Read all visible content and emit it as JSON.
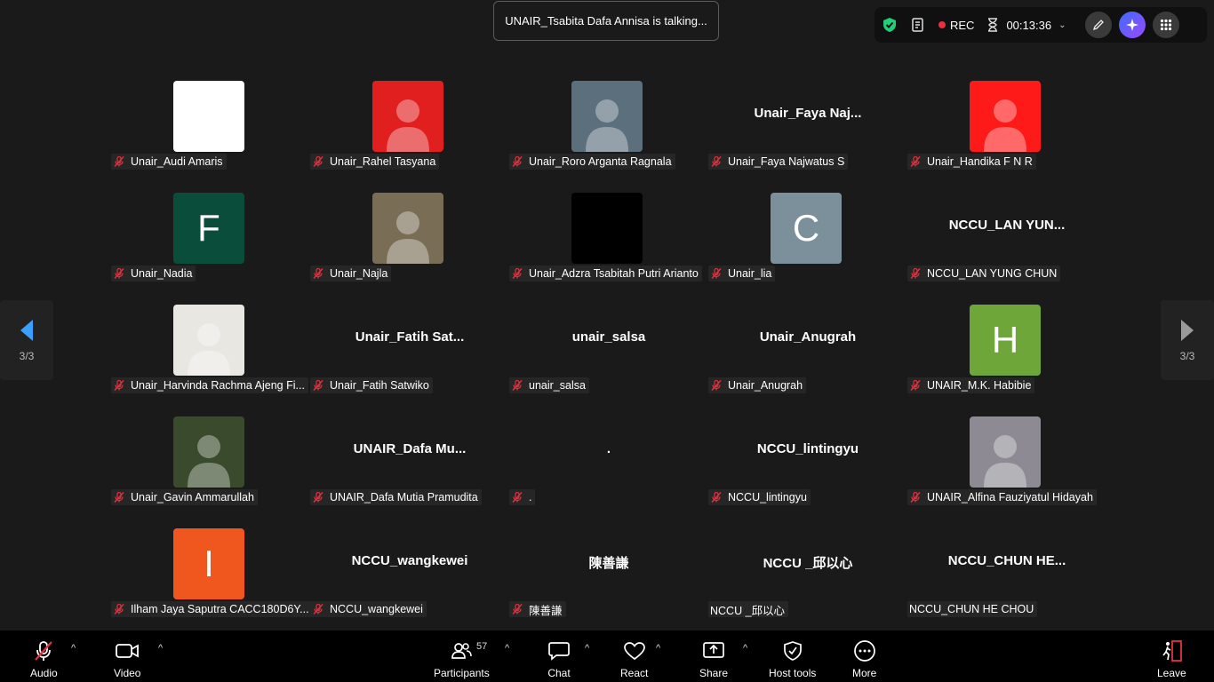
{
  "banner": {
    "talking": "UNAIR_Tsabita Dafa Annisa is talking..."
  },
  "status": {
    "rec": "REC",
    "timer": "00:13:36"
  },
  "nav": {
    "page": "3/3"
  },
  "participants": [
    {
      "name": "Unair_Audi Amaris",
      "tile": "",
      "color": "#ffffff"
    },
    {
      "name": "Unair_Rahel Tasyana",
      "tile": "photo",
      "color": "#e11f1f"
    },
    {
      "name": "Unair_Roro Arganta Ragnala",
      "tile": "photo",
      "color": "#5b6f7d"
    },
    {
      "name": "Unair_Faya Najwatus S",
      "display": "Unair_Faya  Naj..."
    },
    {
      "name": "Unair_Handika F N R",
      "tile": "photo",
      "color": "#ff1a1a"
    },
    {
      "name": "Unair_Nadia",
      "tile": "F",
      "color": "#0b4d3b"
    },
    {
      "name": "Unair_Najla",
      "tile": "photo",
      "color": "#7a6d55"
    },
    {
      "name": "Unair_Adzra Tsabitah Putri Arianto",
      "tile": "",
      "color": "#000000"
    },
    {
      "name": "Unair_lia",
      "tile": "C",
      "color": "#7b909b"
    },
    {
      "name": "NCCU_LAN YUNG CHUN",
      "display": "NCCU_LAN  YUN..."
    },
    {
      "name": "Unair_Harvinda Rachma Ajeng Fi...",
      "tile": "photo",
      "color": "#e9e7e2"
    },
    {
      "name": "Unair_Fatih Satwiko",
      "display": "Unair_Fatih  Sat..."
    },
    {
      "name": "unair_salsa",
      "display": "unair_salsa"
    },
    {
      "name": "Unair_Anugrah",
      "display": "Unair_Anugrah"
    },
    {
      "name": "UNAIR_M.K. Habibie",
      "tile": "H",
      "color": "#6ea63a"
    },
    {
      "name": "Unair_Gavin Ammarullah",
      "tile": "photo",
      "color": "#3a4a2c"
    },
    {
      "name": "UNAIR_Dafa Mutia Pramudita",
      "display": "UNAIR_Dafa  Mu..."
    },
    {
      "name": ".",
      "display": "."
    },
    {
      "name": "NCCU_lintingyu",
      "display": "NCCU_lintingyu"
    },
    {
      "name": "UNAIR_Alfina Fauziyatul Hidayah",
      "tile": "photo",
      "color": "#8d8a93"
    },
    {
      "name": "Ilham Jaya Saputra CACC180D6Y...",
      "tile": "I",
      "color": "#f0571f"
    },
    {
      "name": "NCCU_wangkewei",
      "display": "NCCU_wangkewei"
    },
    {
      "name": "陳善謙",
      "display": "陳善謙"
    },
    {
      "name": "NCCU _邱以心",
      "display": "NCCU _邱以心",
      "unmuted": true
    },
    {
      "name": "NCCU_CHUN HE CHOU",
      "display": "NCCU_CHUN  HE...",
      "unmuted": true
    }
  ],
  "toolbar": {
    "audio": "Audio",
    "video": "Video",
    "participants": "Participants",
    "participants_count": "57",
    "chat": "Chat",
    "react": "React",
    "share": "Share",
    "host_tools": "Host tools",
    "more": "More",
    "leave": "Leave"
  }
}
